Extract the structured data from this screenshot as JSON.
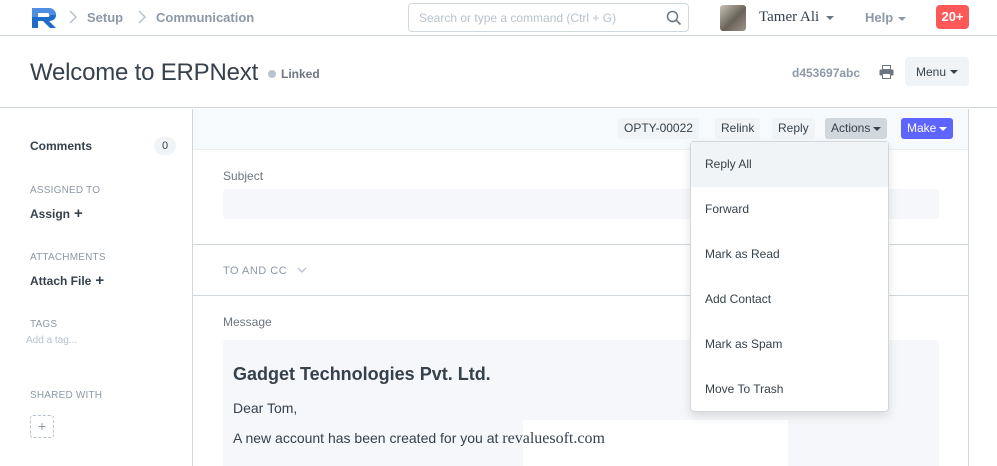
{
  "navbar": {
    "breadcrumbs": [
      "Setup",
      "Communication"
    ],
    "search_placeholder": "Search or type a command (Ctrl + G)",
    "user_name": "Tamer Ali",
    "help_label": "Help",
    "notification_count": "20+"
  },
  "page_head": {
    "title": "Welcome to ERPNext",
    "status": "Linked",
    "doc_id": "d453697abc",
    "menu_label": "Menu"
  },
  "sidebar": {
    "comments_label": "Comments",
    "comments_count": "0",
    "assigned_to_label": "ASSIGNED TO",
    "assign_action": "Assign",
    "attachments_label": "ATTACHMENTS",
    "attach_action": "Attach File",
    "tags_label": "TAGS",
    "tags_placeholder": "Add a tag...",
    "shared_with_label": "SHARED WITH",
    "share_add": "+"
  },
  "toolbar": {
    "opportunity": "OPTY-00022",
    "relink": "Relink",
    "reply": "Reply",
    "actions": "Actions",
    "make": "Make"
  },
  "form": {
    "subject_label": "Subject",
    "to_cc_label": "TO AND CC",
    "message_label": "Message",
    "message": {
      "company": "Gadget Technologies Pvt. Ltd.",
      "greeting": "Dear Tom,",
      "body_prefix": "A new account has been created for you at ",
      "body_url": "revaluesoft.com"
    }
  },
  "actions_menu": {
    "items": [
      "Reply All",
      "Forward",
      "Mark as Read",
      "Add Contact",
      "Mark as Spam",
      "Move To Trash"
    ],
    "highlighted": "Reply All"
  },
  "colors": {
    "primary": "#5e64ff",
    "notification": "#ff5858",
    "logo": "#5e64ff"
  }
}
